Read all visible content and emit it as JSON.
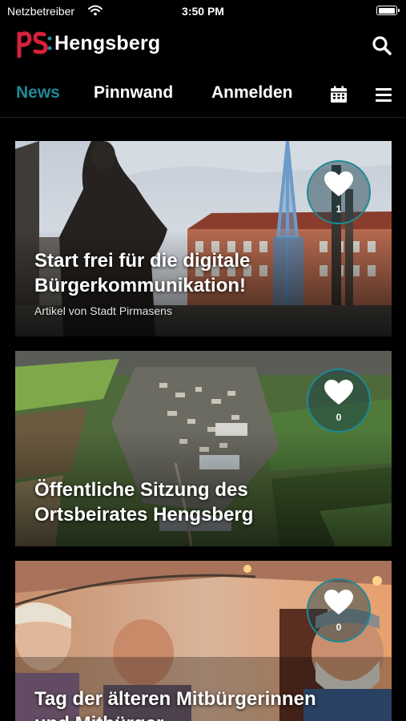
{
  "status_bar": {
    "carrier": "Netzbetreiber",
    "time": "3:50 PM",
    "battery_level": 1.0
  },
  "header": {
    "logo_mark": "pS:",
    "app_name": "Hengsberg",
    "search_icon": "search-icon"
  },
  "tabs": [
    {
      "label": "News",
      "active": true
    },
    {
      "label": "Pinnwand",
      "active": false
    },
    {
      "label": "Anmelden",
      "active": false
    }
  ],
  "tab_icons": [
    "calendar-icon",
    "menu-icon"
  ],
  "colors": {
    "accent": "#1f8a96",
    "logo_red": "#d6213b",
    "background": "#000000"
  },
  "articles": [
    {
      "title": "Start frei für die digitale Bürgerkommunikation!",
      "subtitle": "Artikel von Stadt Pirmasens",
      "likes": "1"
    },
    {
      "title": "Öffentliche Sitzung des Ortsbeirates Hengsberg",
      "subtitle": "",
      "likes": "0"
    },
    {
      "title": "Tag der älteren Mitbürgerinnen und Mitbürger",
      "subtitle": "",
      "likes": "0"
    }
  ]
}
